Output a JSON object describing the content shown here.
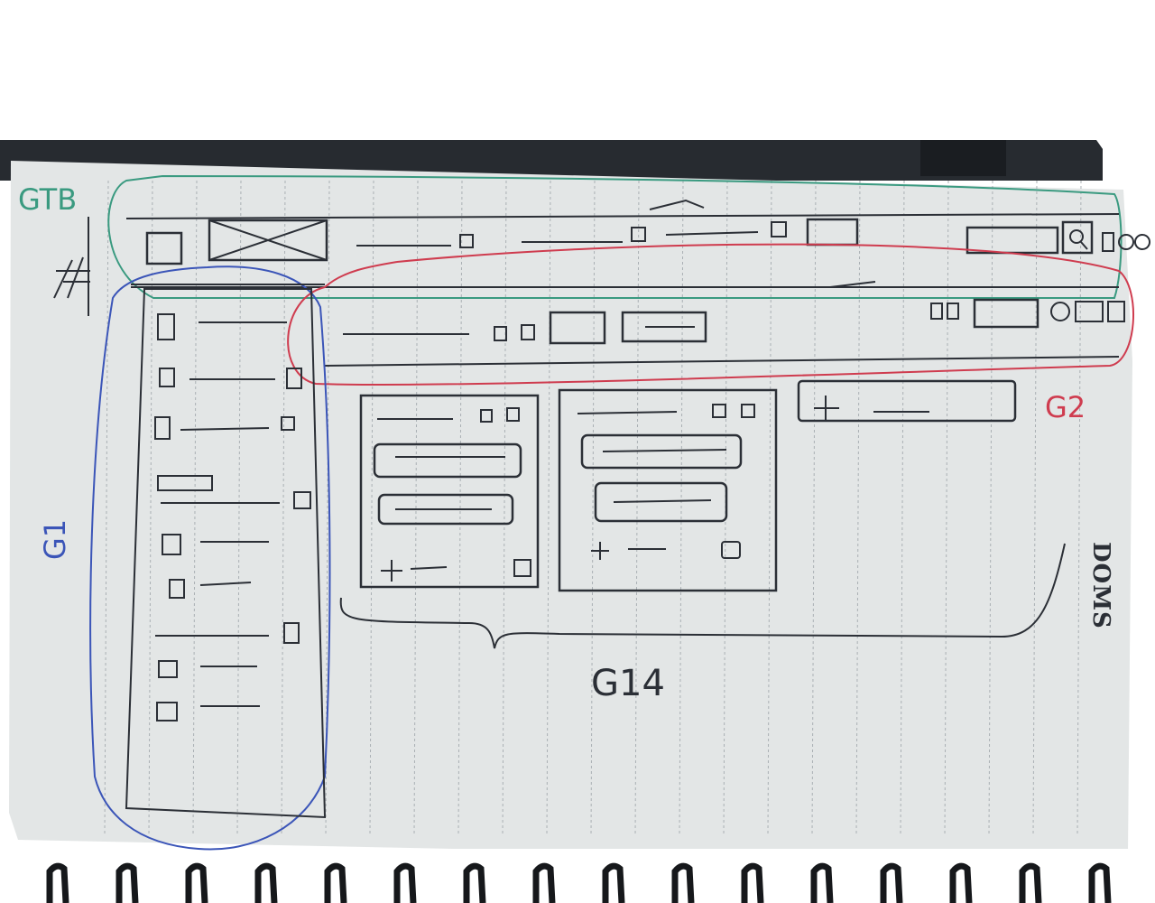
{
  "labels": {
    "top_bar": "GTB",
    "nav_panel": "G1",
    "sub_header": "G2",
    "card_area": "G14"
  },
  "notebook_brand": "DOMS",
  "colors": {
    "paper": "#e3e6e6",
    "ink": "#2b2f36",
    "green": "#3a9a80",
    "blue": "#3b55b8",
    "red": "#cf3c4f",
    "notebook_cover": "#272b30"
  },
  "icons": {
    "search": "search-icon",
    "close_box": "image-placeholder-x"
  }
}
